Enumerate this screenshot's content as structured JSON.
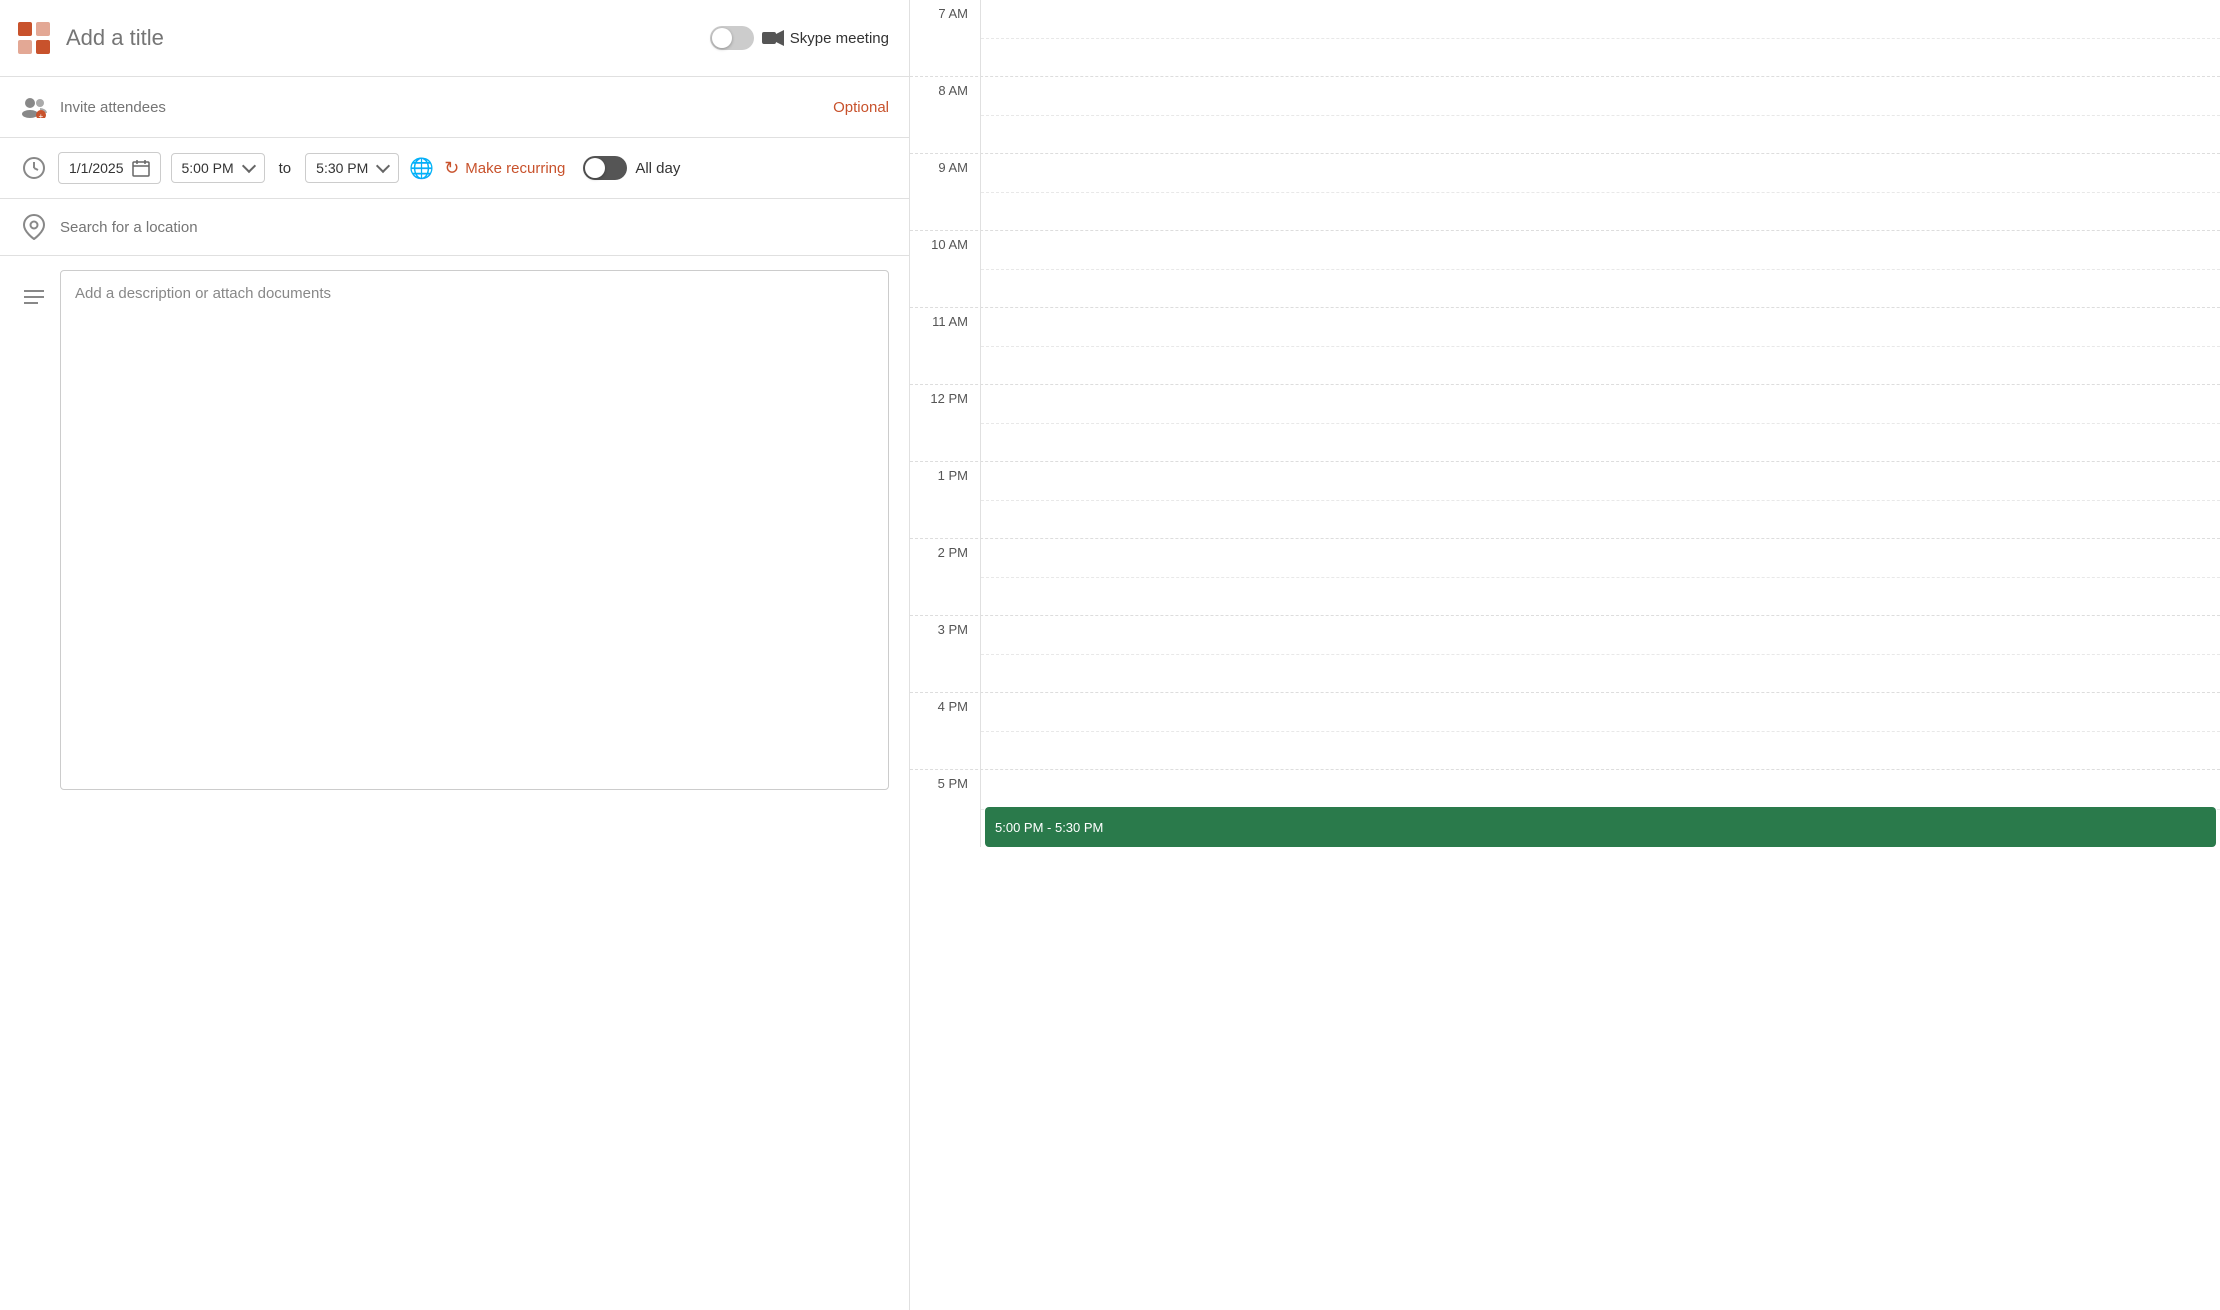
{
  "form": {
    "title_placeholder": "Add a title",
    "skype_label": "Skype meeting",
    "attendees_placeholder": "Invite attendees",
    "optional_label": "Optional",
    "date_value": "1/1/2025",
    "start_time": "5:00 PM",
    "end_time": "5:30 PM",
    "separator": "to",
    "make_recurring_label": "Make recurring",
    "all_day_label": "All day",
    "location_placeholder": "Search for a location",
    "description_placeholder": "Add a description or attach documents"
  },
  "calendar": {
    "time_slots": [
      {
        "label": "7 AM"
      },
      {
        "label": "8 AM"
      },
      {
        "label": "9 AM"
      },
      {
        "label": "10 AM"
      },
      {
        "label": "11 AM"
      },
      {
        "label": "12 PM"
      },
      {
        "label": "1 PM"
      },
      {
        "label": "2 PM"
      },
      {
        "label": "3 PM"
      },
      {
        "label": "4 PM"
      },
      {
        "label": "5 PM"
      }
    ],
    "event_block": {
      "text": "5:00 PM - 5:30 PM"
    }
  }
}
